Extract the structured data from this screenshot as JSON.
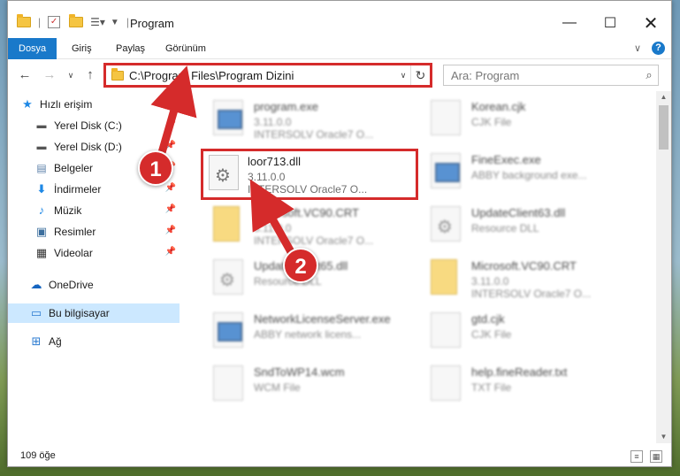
{
  "window": {
    "title": "Program"
  },
  "ribbon": {
    "tabs": [
      "Dosya",
      "Giriş",
      "Paylaş",
      "Görünüm"
    ]
  },
  "address": {
    "path": "C:\\Program Files\\Program Dizini"
  },
  "search": {
    "placeholder": "Ara: Program"
  },
  "sidebar": {
    "quick_access": "Hızlı erişim",
    "items": [
      "Yerel Disk (C:)",
      "Yerel Disk (D:)",
      "Belgeler",
      "İndirmeler",
      "Müzik",
      "Resimler",
      "Videolar"
    ],
    "onedrive": "OneDrive",
    "this_pc": "Bu bilgisayar",
    "network": "Ağ"
  },
  "files": {
    "left": [
      {
        "name": "program.exe",
        "line2": "3.11.0.0",
        "line3": "INTERSOLV Oracle7 O..."
      },
      {
        "name": "Microsoft.VC90.CRT",
        "line2": "3.11.0.0",
        "line3": "INTERSOLV Oracle7 O..."
      },
      {
        "name": "UpdateClient65.dll",
        "line2": "Resource DLL",
        "line3": ""
      },
      {
        "name": "NetworkLicenseServer.exe",
        "line2": "ABBY network licens...",
        "line3": ""
      },
      {
        "name": "SndToWP14.wcm",
        "line2": "WCM File",
        "line3": ""
      }
    ],
    "right": [
      {
        "name": "Korean.cjk",
        "line2": "CJK File",
        "line3": ""
      },
      {
        "name": "FineExec.exe",
        "line2": "ABBY background exe...",
        "line3": ""
      },
      {
        "name": "UpdateClient63.dll",
        "line2": "Resource DLL",
        "line3": ""
      },
      {
        "name": "Microsoft.VC90.CRT",
        "line2": "3.11.0.0",
        "line3": "INTERSOLV Oracle7 O..."
      },
      {
        "name": "gtd.cjk",
        "line2": "CJK File",
        "line3": ""
      },
      {
        "name": "help.fineReader.txt",
        "line2": "TXT File",
        "line3": ""
      }
    ],
    "highlighted": {
      "name": "loor713.dll",
      "line2": "3.11.0.0",
      "line3": "INTERSOLV Oracle7 O..."
    }
  },
  "status": {
    "count": "109 öğe"
  },
  "annotations": {
    "step1": "1",
    "step2": "2"
  },
  "colors": {
    "accent": "#1979ca",
    "highlight": "#d52b2b",
    "selected": "#cce8ff"
  }
}
